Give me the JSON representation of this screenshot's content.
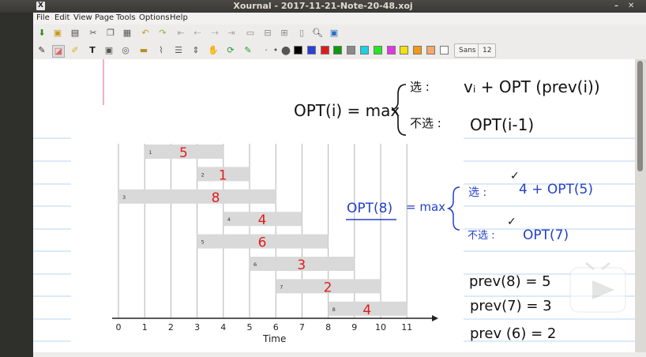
{
  "window": {
    "title": "Xournal - 2017-11-21-Note-20-48.xoj",
    "app_icon": "X"
  },
  "menu": [
    "File",
    "Edit",
    "View",
    "Page",
    "Tools",
    "Options",
    "Help"
  ],
  "toolbar": {
    "font_name": "Sans",
    "font_size": "12"
  },
  "palette": [
    "#000000",
    "#2b3fd9",
    "#e11b1b",
    "#0c9b0c",
    "#8a8a8a",
    "#1ad1e6",
    "#21e821",
    "#e038e0",
    "#f2e20c",
    "#f39a12",
    "#f5a86a",
    "#ffffff"
  ],
  "formula": {
    "lhs": "OPT(i) = max",
    "choose": "选 :",
    "choose_expr": "vᵢ + OPT (prev(i))",
    "not_choose": "不选 :",
    "not_choose_expr": "OPT(i-1)"
  },
  "example": {
    "lhs": "OPT(8)",
    "eq": "= max",
    "choose": "选 :",
    "choose_expr": "4 + OPT(5)",
    "not_choose": "不选 :",
    "not_choose_expr": "OPT(7)",
    "check": "✓"
  },
  "prev_list": [
    "prev(8) = 5",
    "prev(7) = 3",
    "prev (6) = 2"
  ],
  "chart_data": {
    "type": "bar",
    "xlabel": "Time",
    "xlim": [
      0,
      11
    ],
    "x_ticks": [
      "0",
      "1",
      "2",
      "3",
      "4",
      "5",
      "6",
      "7",
      "8",
      "9",
      "10",
      "11"
    ],
    "intervals": [
      {
        "id": "1",
        "start": 1,
        "end": 4,
        "value": "5"
      },
      {
        "id": "2",
        "start": 3,
        "end": 5,
        "value": "1"
      },
      {
        "id": "3",
        "start": 0,
        "end": 6,
        "value": "8"
      },
      {
        "id": "4",
        "start": 4,
        "end": 7,
        "value": "4"
      },
      {
        "id": "5",
        "start": 3,
        "end": 8,
        "value": "6"
      },
      {
        "id": "6",
        "start": 5,
        "end": 9,
        "value": "3"
      },
      {
        "id": "7",
        "start": 6,
        "end": 10,
        "value": "2"
      },
      {
        "id": "8",
        "start": 8,
        "end": 11,
        "value": "4"
      }
    ]
  }
}
